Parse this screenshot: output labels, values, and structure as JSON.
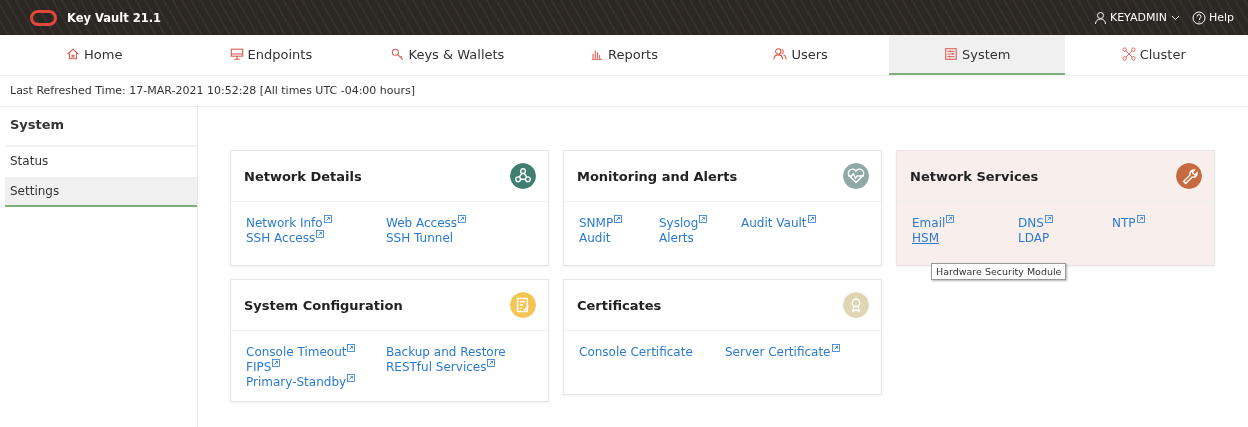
{
  "header": {
    "product": "Key Vault 21.1",
    "user": "KEYADMIN",
    "help": "Help"
  },
  "tabs": [
    {
      "label": "Home",
      "selected": false
    },
    {
      "label": "Endpoints",
      "selected": false
    },
    {
      "label": "Keys & Wallets",
      "selected": false
    },
    {
      "label": "Reports",
      "selected": false
    },
    {
      "label": "Users",
      "selected": false
    },
    {
      "label": "System",
      "selected": true
    },
    {
      "label": "Cluster",
      "selected": false
    }
  ],
  "refreshed": "Last Refreshed Time: 17-MAR-2021 10:52:28 [All times UTC -04:00 hours]",
  "sidebar": {
    "title": "System",
    "items": [
      {
        "label": "Status",
        "selected": false
      },
      {
        "label": "Settings",
        "selected": true
      }
    ]
  },
  "cards": [
    {
      "title": "Network Details",
      "color": "#3f7f73",
      "highlighted": false,
      "links": [
        {
          "label": "Network Info",
          "external": true,
          "hovered": false
        },
        {
          "label": "Web Access",
          "external": true,
          "hovered": false
        },
        {
          "label": "SSH Access",
          "external": true,
          "hovered": false
        },
        {
          "label": "SSH Tunnel",
          "external": false,
          "hovered": false
        }
      ]
    },
    {
      "title": "Monitoring and Alerts",
      "color": "#8fa9a4",
      "highlighted": false,
      "links": [
        {
          "label": "SNMP",
          "external": true,
          "hovered": false
        },
        {
          "label": "Syslog",
          "external": true,
          "hovered": false
        },
        {
          "label": "Audit Vault",
          "external": true,
          "hovered": false
        },
        {
          "label": "Audit",
          "external": false,
          "hovered": false
        },
        {
          "label": "Alerts",
          "external": false,
          "hovered": false
        }
      ]
    },
    {
      "title": "Network Services",
      "color": "#c66a3f",
      "highlighted": true,
      "links": [
        {
          "label": "Email",
          "external": true,
          "hovered": false
        },
        {
          "label": "DNS",
          "external": true,
          "hovered": false
        },
        {
          "label": "NTP",
          "external": true,
          "hovered": false
        },
        {
          "label": "HSM",
          "external": false,
          "hovered": true,
          "tooltip": "Hardware Security Module"
        },
        {
          "label": "LDAP",
          "external": false,
          "hovered": false
        }
      ]
    },
    {
      "title": "System Configuration",
      "color": "#f4c555",
      "highlighted": false,
      "links": [
        {
          "label": "Console Timeout",
          "external": true,
          "hovered": false
        },
        {
          "label": "Backup and Restore",
          "external": false,
          "hovered": false
        },
        {
          "label": "FIPS",
          "external": true,
          "hovered": false
        },
        {
          "label": "RESTful Services",
          "external": true,
          "hovered": false
        },
        {
          "label": "Primary-Standby",
          "external": true,
          "hovered": false
        }
      ]
    },
    {
      "title": "Certificates",
      "color": "#e0d5b5",
      "highlighted": false,
      "links": [
        {
          "label": "Console Certificate",
          "external": false,
          "hovered": false
        },
        {
          "label": "Server Certificate",
          "external": true,
          "hovered": false
        }
      ]
    }
  ]
}
